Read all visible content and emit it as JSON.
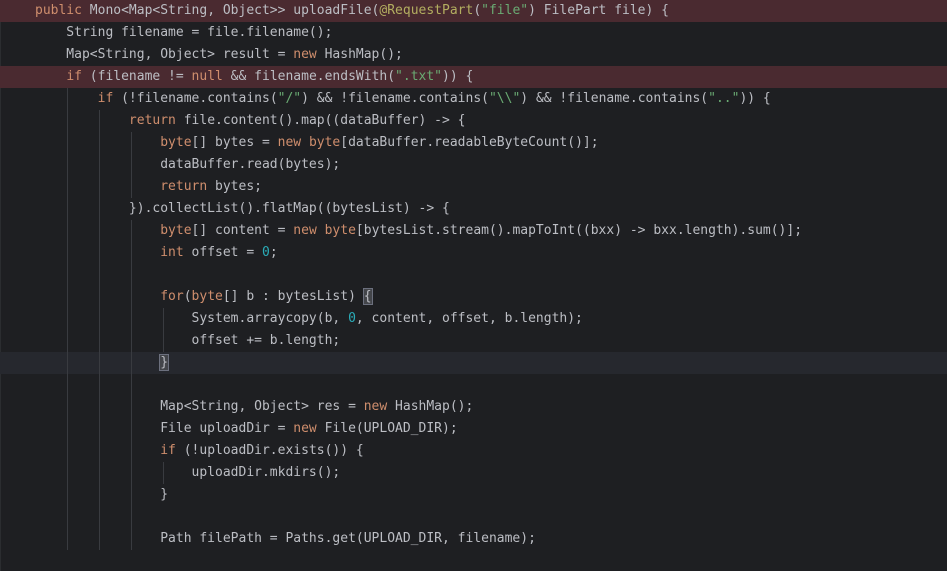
{
  "editor": {
    "lines": [
      {
        "segments": [
          {
            "t": "public",
            "c": "kw"
          },
          {
            "t": " Mono<Map<String, Object>> uploadFile("
          },
          {
            "t": "@RequestPart",
            "c": "ann"
          },
          {
            "t": "("
          },
          {
            "t": "\"file\"",
            "c": "str"
          },
          {
            "t": ") FilePart file) {"
          }
        ]
      },
      {
        "segments": [
          {
            "t": "    String filename = file.filename();"
          }
        ]
      },
      {
        "segments": [
          {
            "t": "    Map<String, Object> result = "
          },
          {
            "t": "new",
            "c": "kw"
          },
          {
            "t": " HashMap();"
          }
        ]
      },
      {
        "segments": [
          {
            "t": "    "
          },
          {
            "t": "if",
            "c": "kw"
          },
          {
            "t": " (filename != "
          },
          {
            "t": "null",
            "c": "kw"
          },
          {
            "t": " && filename.endsWith("
          },
          {
            "t": "\".txt\"",
            "c": "str"
          },
          {
            "t": ")) {"
          }
        ]
      },
      {
        "segments": [
          {
            "t": "        "
          },
          {
            "t": "if",
            "c": "kw"
          },
          {
            "t": " (!filename.contains("
          },
          {
            "t": "\"/\"",
            "c": "str"
          },
          {
            "t": ") && !filename.contains("
          },
          {
            "t": "\"\\\\\"",
            "c": "str"
          },
          {
            "t": ") && !filename.contains("
          },
          {
            "t": "\"..\"",
            "c": "str"
          },
          {
            "t": ")) {"
          }
        ]
      },
      {
        "segments": [
          {
            "t": "            "
          },
          {
            "t": "return",
            "c": "kw"
          },
          {
            "t": " file.content().map((dataBuffer) -> {"
          }
        ]
      },
      {
        "segments": [
          {
            "t": "                "
          },
          {
            "t": "byte",
            "c": "kw"
          },
          {
            "t": "[] bytes = "
          },
          {
            "t": "new",
            "c": "kw"
          },
          {
            "t": " "
          },
          {
            "t": "byte",
            "c": "kw"
          },
          {
            "t": "[dataBuffer.readableByteCount()];"
          }
        ]
      },
      {
        "segments": [
          {
            "t": "                dataBuffer.read(bytes);"
          }
        ]
      },
      {
        "segments": [
          {
            "t": "                "
          },
          {
            "t": "return",
            "c": "kw"
          },
          {
            "t": " bytes;"
          }
        ]
      },
      {
        "segments": [
          {
            "t": "            }).collectList().flatMap((bytesList) -> {"
          }
        ]
      },
      {
        "segments": [
          {
            "t": "                "
          },
          {
            "t": "byte",
            "c": "kw"
          },
          {
            "t": "[] content = "
          },
          {
            "t": "new",
            "c": "kw"
          },
          {
            "t": " "
          },
          {
            "t": "byte",
            "c": "kw"
          },
          {
            "t": "[bytesList.stream().mapToInt((bxx) -> bxx.length).sum()];"
          }
        ]
      },
      {
        "segments": [
          {
            "t": "                "
          },
          {
            "t": "int",
            "c": "kw"
          },
          {
            "t": " offset = "
          },
          {
            "t": "0",
            "c": "num"
          },
          {
            "t": ";"
          }
        ]
      },
      {
        "segments": [
          {
            "t": ""
          }
        ]
      },
      {
        "segments": [
          {
            "t": "                "
          },
          {
            "t": "for",
            "c": "kw"
          },
          {
            "t": "("
          },
          {
            "t": "byte",
            "c": "kw"
          },
          {
            "t": "[] b : bytesList) "
          },
          {
            "t": "{",
            "c": "brace-match"
          }
        ]
      },
      {
        "segments": [
          {
            "t": "                    System.arraycopy(b, "
          },
          {
            "t": "0",
            "c": "num"
          },
          {
            "t": ", content, offset, b.length);"
          }
        ]
      },
      {
        "segments": [
          {
            "t": "                    offset += b.length;"
          }
        ]
      },
      {
        "segments": [
          {
            "t": "                "
          },
          {
            "t": "}",
            "c": "brace-match"
          }
        ]
      },
      {
        "segments": [
          {
            "t": ""
          }
        ]
      },
      {
        "segments": [
          {
            "t": "                Map<String, Object> res = "
          },
          {
            "t": "new",
            "c": "kw"
          },
          {
            "t": " HashMap();"
          }
        ]
      },
      {
        "segments": [
          {
            "t": "                File uploadDir = "
          },
          {
            "t": "new",
            "c": "kw"
          },
          {
            "t": " File(UPLOAD_DIR);"
          }
        ]
      },
      {
        "segments": [
          {
            "t": "                "
          },
          {
            "t": "if",
            "c": "kw"
          },
          {
            "t": " (!uploadDir.exists()) {"
          }
        ]
      },
      {
        "segments": [
          {
            "t": "                    uploadDir.mkdirs();"
          }
        ]
      },
      {
        "segments": [
          {
            "t": "                }"
          }
        ]
      },
      {
        "segments": [
          {
            "t": ""
          }
        ]
      },
      {
        "segments": [
          {
            "t": "                Path filePath = Paths.get(UPLOAD_DIR, filename);"
          }
        ]
      },
      {
        "segments": [
          {
            "t": ""
          }
        ]
      }
    ]
  },
  "colors": {
    "background": "#1e1f22",
    "default_text": "#bcbec4",
    "keyword": "#cf8e6d",
    "string": "#6aab73",
    "number": "#2aacb8",
    "annotation": "#b3ae60",
    "error_line_highlight": "#4a2a30",
    "caret_line_highlight": "#26282e"
  }
}
